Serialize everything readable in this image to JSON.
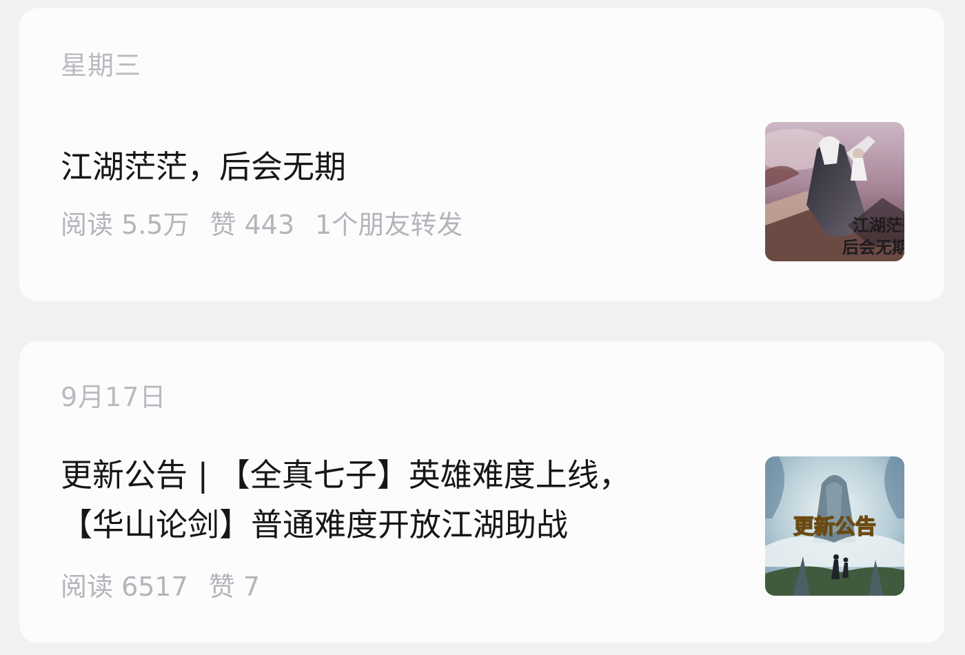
{
  "articles": [
    {
      "date": "星期三",
      "title": "江湖茫茫，后会无期",
      "stats": [
        "阅读 5.5万",
        "赞 443",
        "1个朋友转发"
      ],
      "thumbnail_text": [
        "江湖茫茫",
        "后会无期"
      ]
    },
    {
      "date": "9月17日",
      "title_lines": [
        "更新公告 | 【全真七子】英雄难度上线，",
        "【华山论剑】普通难度开放江湖助战"
      ],
      "stats": [
        "阅读 6517",
        "赞 7"
      ],
      "thumbnail_text": "更新公告"
    }
  ],
  "colors": {
    "page_bg": "#f1f1f4",
    "card_bg": "#fcfcfd",
    "title": "#161616",
    "meta": "#b4b4bb"
  }
}
